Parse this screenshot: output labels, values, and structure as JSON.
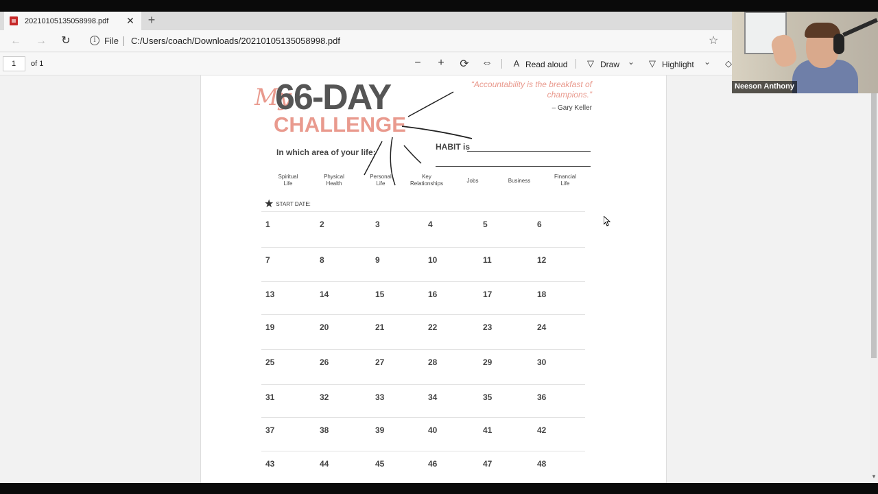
{
  "browser": {
    "tab_title": "20210105135058998.pdf",
    "close_glyph": "✕",
    "new_tab_glyph": "+",
    "file_label": "File",
    "url": "C:/Users/coach/Downloads/20210105135058998.pdf"
  },
  "pdf_toolbar": {
    "page_number": "1",
    "page_of": "of 1",
    "read_aloud": "Read aloud",
    "draw": "Draw",
    "highlight": "Highlight"
  },
  "document": {
    "title_number": "66-DAY",
    "title_word": "CHALLENGE",
    "handwritten_prefix": "My",
    "quote": "“Accountability is the breakfast of champions.”",
    "quote_author": "– Gary Keller",
    "area_prompt": "In which area of your life:",
    "habit_prompt": "HABIT is",
    "areas": [
      {
        "line1": "Spiritual",
        "line2": "Life"
      },
      {
        "line1": "Physical",
        "line2": "Health"
      },
      {
        "line1": "Personal",
        "line2": "Life"
      },
      {
        "line1": "Key",
        "line2": "Relationships"
      },
      {
        "line1": "Jobs",
        "line2": ""
      },
      {
        "line1": "Business",
        "line2": ""
      },
      {
        "line1": "Financial",
        "line2": "Life"
      }
    ],
    "start_date": "START DATE:",
    "days": [
      [
        "1",
        "2",
        "3",
        "4",
        "5",
        "6"
      ],
      [
        "7",
        "8",
        "9",
        "10",
        "11",
        "12"
      ],
      [
        "13",
        "14",
        "15",
        "16",
        "17",
        "18"
      ],
      [
        "19",
        "20",
        "21",
        "22",
        "23",
        "24"
      ],
      [
        "25",
        "26",
        "27",
        "28",
        "29",
        "30"
      ],
      [
        "31",
        "32",
        "33",
        "34",
        "35",
        "36"
      ],
      [
        "37",
        "38",
        "39",
        "40",
        "41",
        "42"
      ],
      [
        "43",
        "44",
        "45",
        "46",
        "47",
        "48"
      ]
    ]
  },
  "webcam": {
    "participant_name": "Neeson Anthony"
  }
}
